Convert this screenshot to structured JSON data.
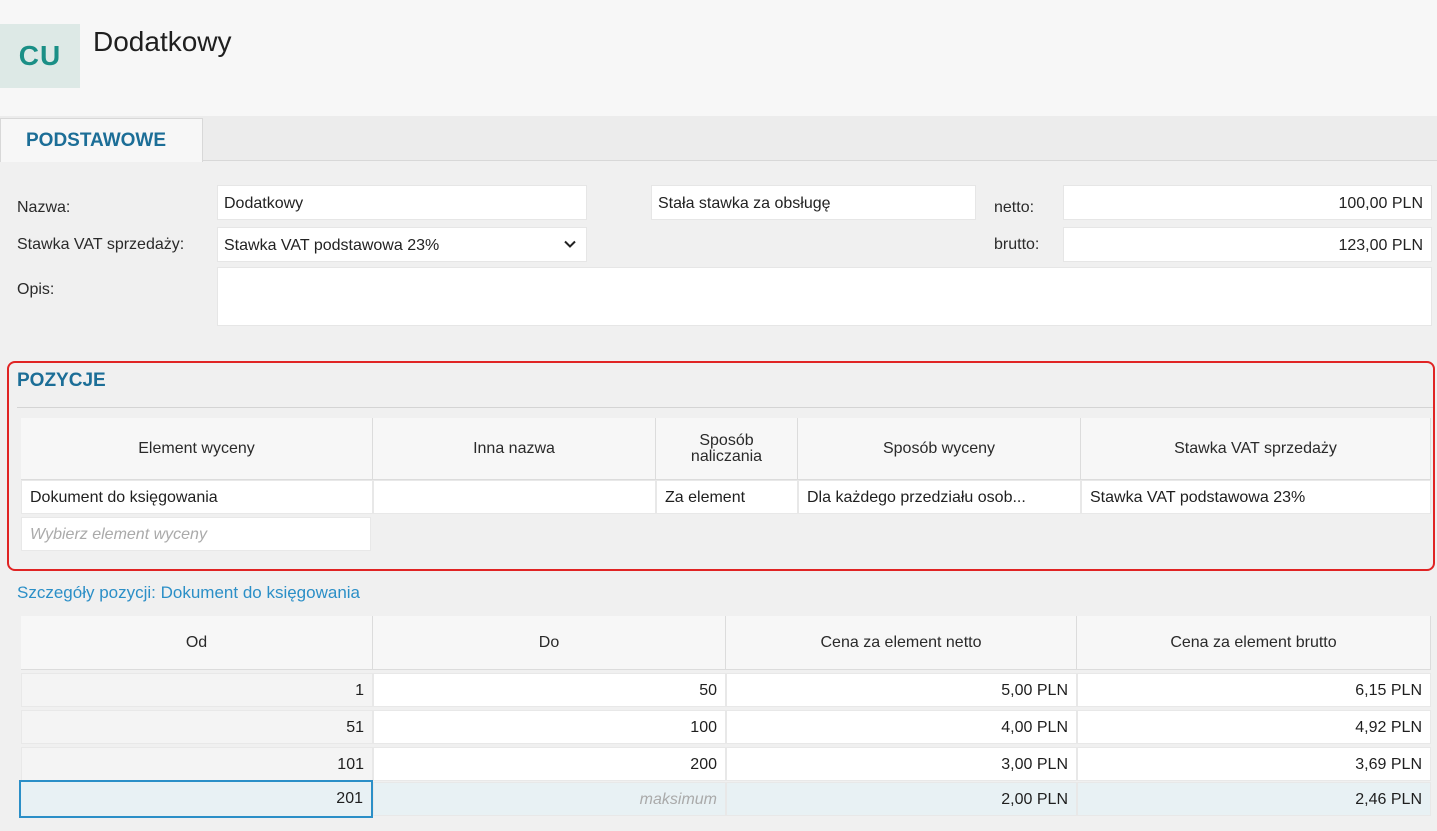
{
  "header": {
    "avatar": "CU",
    "title": "Dodatkowy"
  },
  "tabs": [
    {
      "label": "PODSTAWOWE",
      "active": true
    }
  ],
  "form": {
    "name_label": "Nazwa:",
    "name_value": "Dodatkowy",
    "vat_label": "Stawka VAT sprzedaży:",
    "vat_value": "Stawka VAT podstawowa 23%",
    "desc_label": "Opis:",
    "desc_value": "",
    "pricing_mode": "Stała stawka za obsługę",
    "net_label": "netto:",
    "net_value": "100,00 PLN",
    "gross_label": "brutto:",
    "gross_value": "123,00 PLN"
  },
  "positions": {
    "title": "POZYCJE",
    "columns": [
      "Element wyceny",
      "Inna nazwa",
      "Sposób naliczania",
      "Sposób wyceny",
      "Stawka VAT sprzedaży"
    ],
    "rows": [
      {
        "element": "Dokument do księgowania",
        "alt_name": "",
        "charging": "Za element",
        "pricing": "Dla każdego przedziału osob...",
        "vat": "Stawka VAT podstawowa 23%"
      }
    ],
    "new_row_placeholder": "Wybierz element wyceny"
  },
  "details": {
    "title": "Szczegóły pozycji: Dokument do księgowania",
    "columns": [
      "Od",
      "Do",
      "Cena za element netto",
      "Cena za element brutto"
    ],
    "rows": [
      {
        "from": "1",
        "to": "50",
        "net": "5,00 PLN",
        "gross": "6,15 PLN"
      },
      {
        "from": "51",
        "to": "100",
        "net": "4,00 PLN",
        "gross": "4,92 PLN"
      },
      {
        "from": "101",
        "to": "200",
        "net": "3,00 PLN",
        "gross": "3,69 PLN"
      },
      {
        "from": "201",
        "to": "",
        "net": "2,00 PLN",
        "gross": "2,46 PLN"
      }
    ],
    "max_placeholder": "maksimum"
  },
  "colors": {
    "accent": "#1c6e97",
    "link": "#2b8fc7",
    "highlight_border": "#e02424",
    "avatar_bg": "#dde9e6",
    "avatar_fg": "#1a8f86"
  },
  "icons": {
    "vat_dropdown": "chevron-down-icon"
  }
}
